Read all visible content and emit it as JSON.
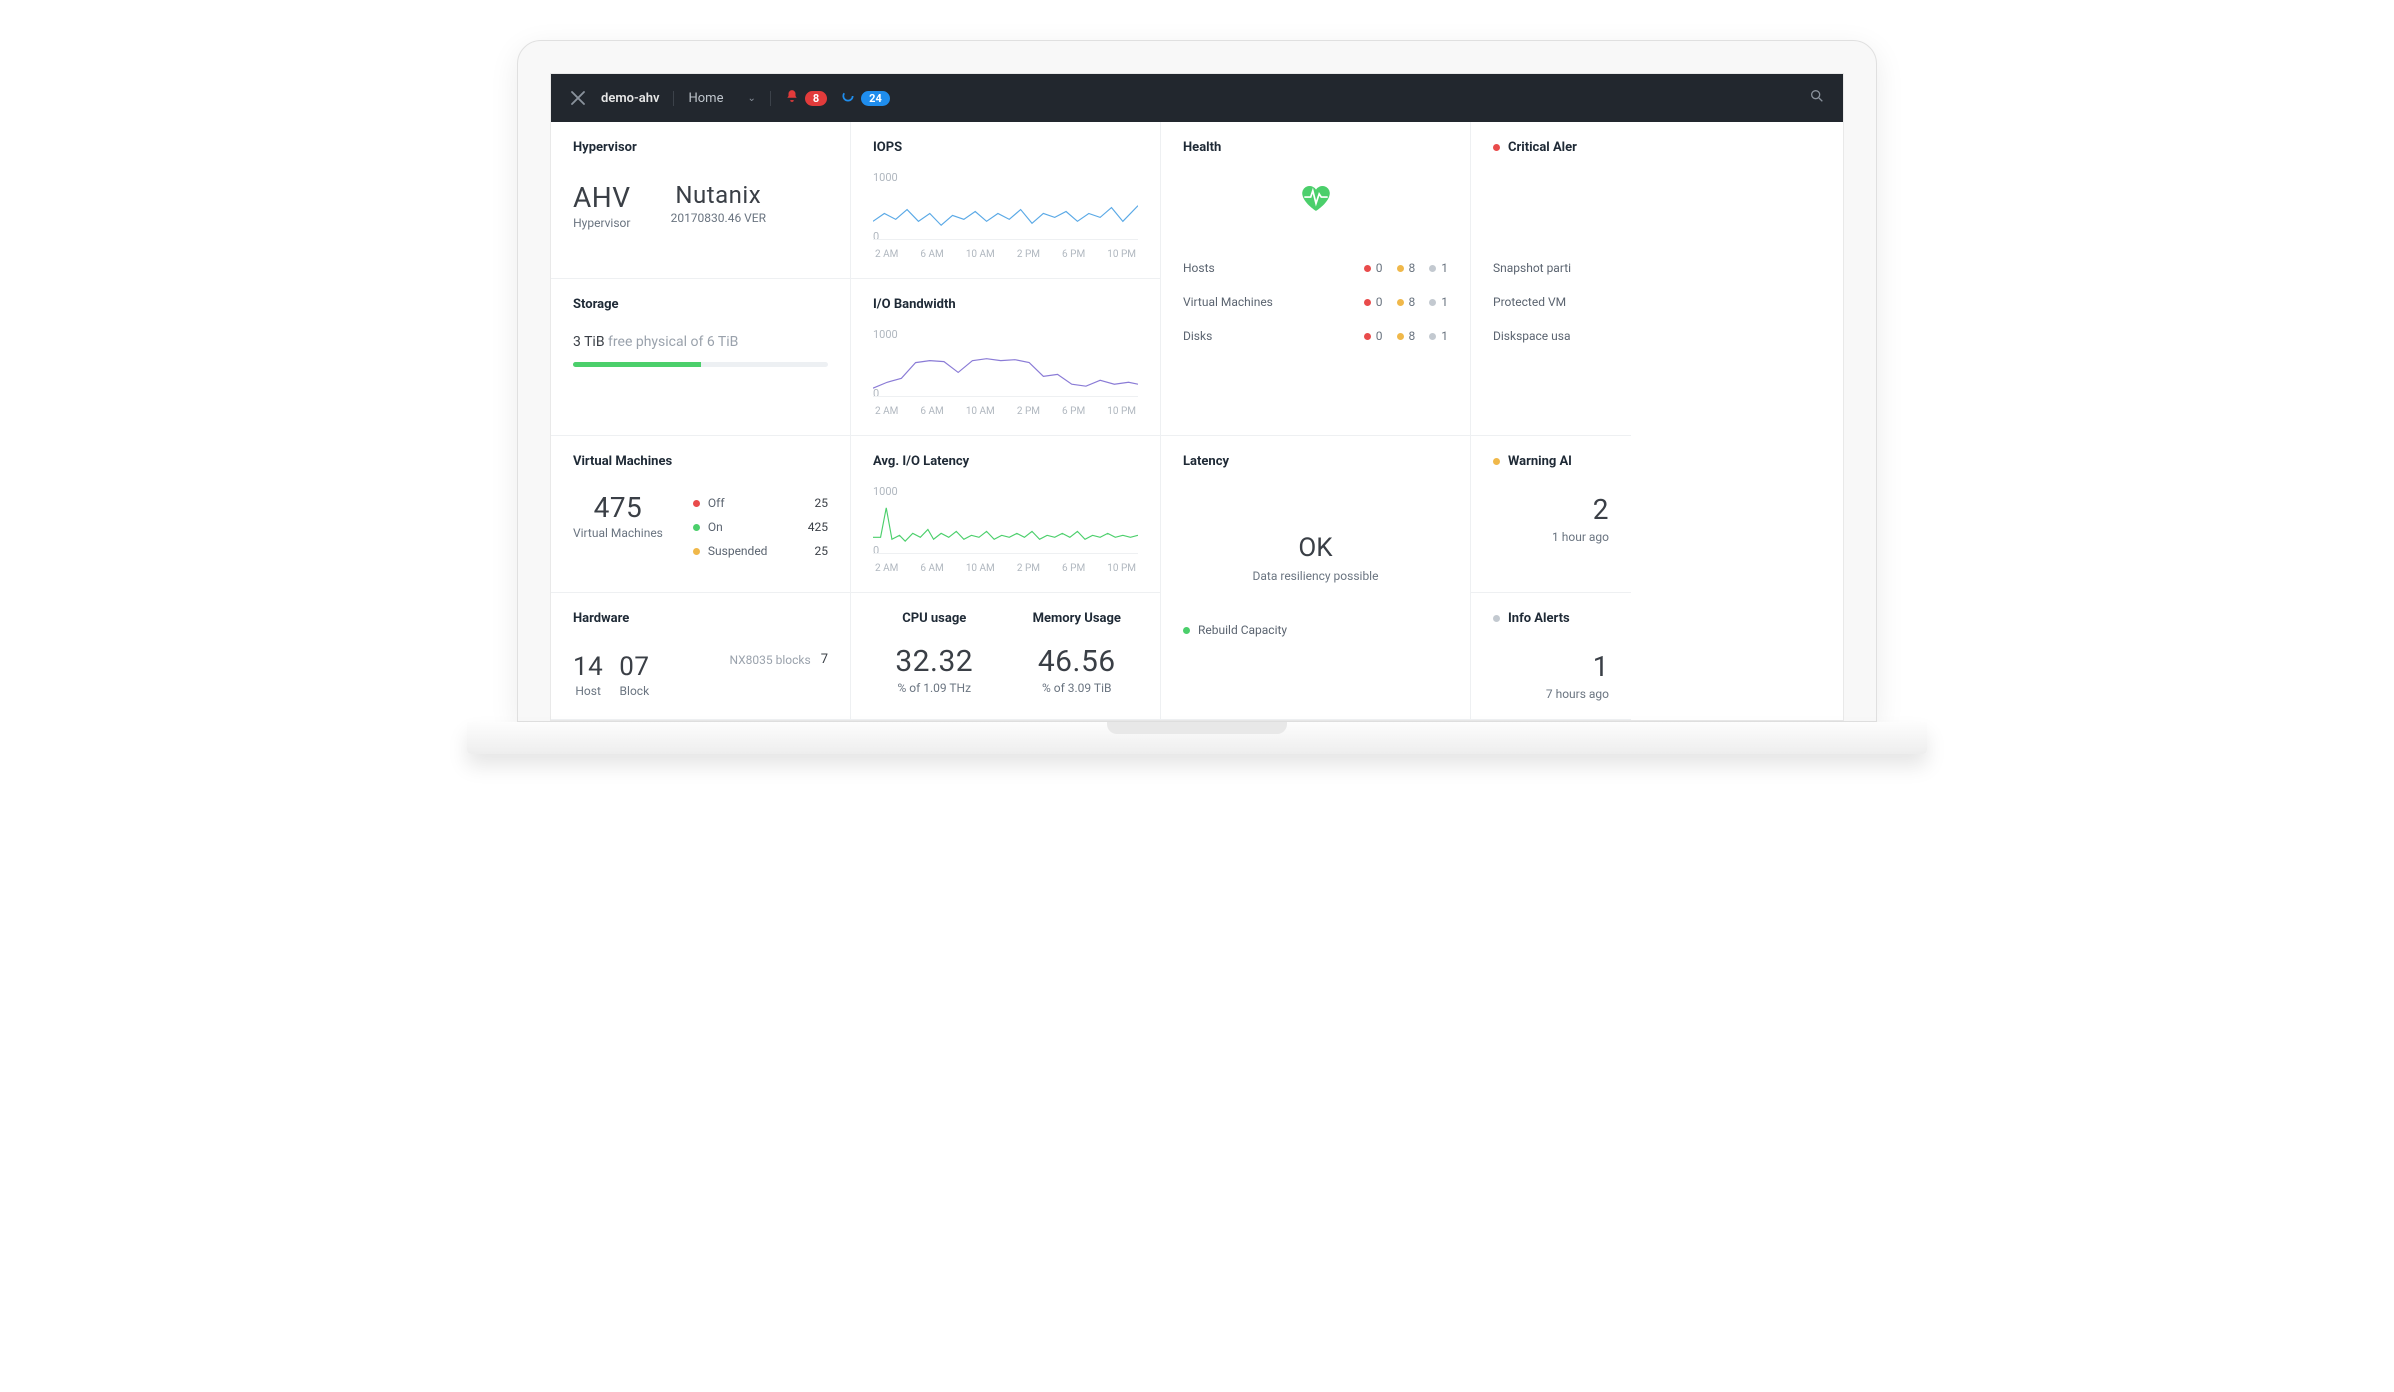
{
  "topbar": {
    "cluster_name": "demo-ahv",
    "page_label": "Home",
    "alert_count": "8",
    "task_count": "24"
  },
  "hypervisor": {
    "title": "Hypervisor",
    "name": "AHV",
    "name_label": "Hypervisor",
    "vendor": "Nutanix",
    "version": "20170830.46 VER"
  },
  "storage": {
    "title": "Storage",
    "free_value": "3 TiB",
    "free_label": "free physical of",
    "total_value": "6 TiB",
    "fill_pct": 50
  },
  "iops": {
    "title": "IOPS",
    "ymax_label": "1000",
    "ymin_label": "0",
    "xticks": [
      "2 AM",
      "6 AM",
      "10 AM",
      "2 PM",
      "6 PM",
      "10 PM"
    ]
  },
  "iobw": {
    "title": "I/O Bandwidth",
    "ymax_label": "1000",
    "ymin_label": "0",
    "xticks": [
      "2 AM",
      "6 AM",
      "10 AM",
      "2 PM",
      "6 PM",
      "10 PM"
    ]
  },
  "avglatency": {
    "title": "Avg. I/O Latency",
    "ymax_label": "1000",
    "ymin_label": "0",
    "xticks": [
      "2 AM",
      "6 AM",
      "10 AM",
      "2 PM",
      "6 PM",
      "10 PM"
    ]
  },
  "vm": {
    "title": "Virtual Machines",
    "total": "475",
    "total_label": "Virtual Machines",
    "states": [
      {
        "label": "Off",
        "count": "25",
        "color": "red"
      },
      {
        "label": "On",
        "count": "425",
        "color": "green"
      },
      {
        "label": "Suspended",
        "count": "25",
        "color": "yellow"
      }
    ]
  },
  "hardware": {
    "title": "Hardware",
    "host_count": "14",
    "host_label": "Host",
    "block_count": "07",
    "block_label": "Block",
    "model_label": "NX8035 blocks",
    "model_count": "7"
  },
  "usage": {
    "cpu": {
      "title": "CPU usage",
      "value": "32.32",
      "sub": "% of 1.09 THz"
    },
    "mem": {
      "title": "Memory Usage",
      "value": "46.56",
      "sub": "% of 3.09 TiB"
    }
  },
  "health": {
    "title": "Health",
    "rows": [
      {
        "label": "Hosts",
        "red": "0",
        "yellow": "8",
        "gray": "1"
      },
      {
        "label": "Virtual Machines",
        "red": "0",
        "yellow": "8",
        "gray": "1"
      },
      {
        "label": "Disks",
        "red": "0",
        "yellow": "8",
        "gray": "1"
      }
    ]
  },
  "latency": {
    "title": "Latency",
    "status": "OK",
    "sub": "Data resiliency possible",
    "rebuild_label": "Rebuild Capacity"
  },
  "alerts": {
    "critical": {
      "title": "Critical Aler",
      "items": [
        "Snapshot parti",
        "Protected VM",
        "Diskspace usa"
      ]
    },
    "warning": {
      "title": "Warning Al",
      "count": "2",
      "age": "1 hour ago"
    },
    "info": {
      "title": "Info Alerts",
      "count": "1",
      "age": "7 hours ago"
    }
  },
  "chart_data": [
    {
      "type": "line",
      "title": "IOPS",
      "x": [
        "2 AM",
        "6 AM",
        "10 AM",
        "2 PM",
        "6 PM",
        "10 PM"
      ],
      "series": [
        {
          "name": "IOPS",
          "values_approx": [
            300,
            450,
            350,
            500,
            300,
            400,
            250,
            400,
            350,
            450,
            300,
            400,
            350,
            500,
            300,
            450,
            400,
            600
          ],
          "color": "#5aa9e6"
        }
      ],
      "ylim": [
        0,
        1000
      ]
    },
    {
      "type": "line",
      "title": "I/O Bandwidth",
      "x": [
        "2 AM",
        "6 AM",
        "10 AM",
        "2 PM",
        "6 PM",
        "10 PM"
      ],
      "series": [
        {
          "name": "Bandwidth",
          "values_approx": [
            150,
            250,
            300,
            550,
            600,
            580,
            400,
            600,
            620,
            580,
            600,
            550,
            350,
            400,
            250,
            200,
            300,
            250
          ],
          "color": "#8a7bd6"
        }
      ],
      "ylim": [
        0,
        1000
      ]
    },
    {
      "type": "line",
      "title": "Avg. I/O Latency",
      "x": [
        "2 AM",
        "6 AM",
        "10 AM",
        "2 PM",
        "6 PM",
        "10 PM"
      ],
      "series": [
        {
          "name": "Latency",
          "values_approx": [
            250,
            600,
            250,
            300,
            250,
            350,
            250,
            280,
            300,
            260,
            300,
            320,
            280,
            300,
            260,
            320,
            280,
            300
          ],
          "color": "#4bcf6b"
        }
      ],
      "ylim": [
        0,
        1000
      ]
    }
  ]
}
